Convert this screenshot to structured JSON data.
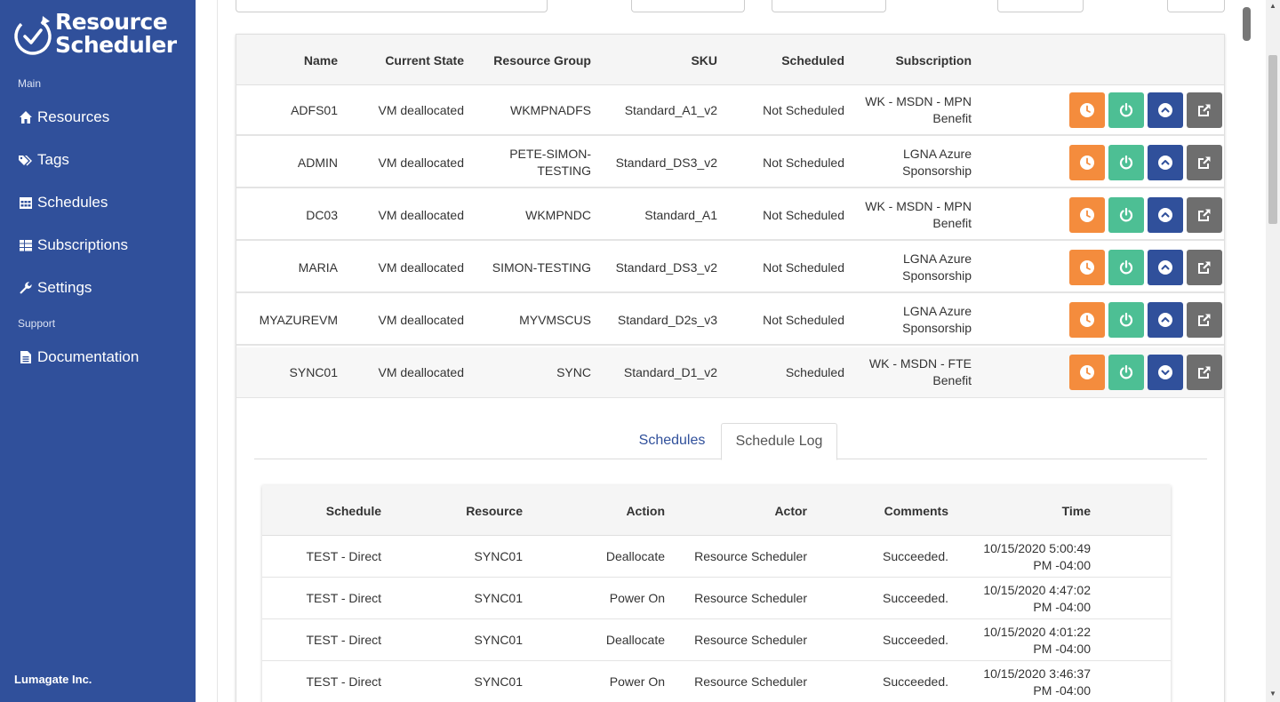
{
  "app": {
    "brand_line1": "Resource",
    "brand_line2": "Scheduler",
    "footer": "Lumagate Inc."
  },
  "sidebar": {
    "sections": [
      "Main",
      "Support"
    ],
    "items": [
      {
        "label": "Resources",
        "icon": "home-icon"
      },
      {
        "label": "Tags",
        "icon": "tags-icon"
      },
      {
        "label": "Schedules",
        "icon": "calendar-icon"
      },
      {
        "label": "Subscriptions",
        "icon": "list-icon"
      },
      {
        "label": "Settings",
        "icon": "wrench-icon"
      },
      {
        "label": "Documentation",
        "icon": "document-icon"
      }
    ]
  },
  "resources_table": {
    "headers": [
      "Name",
      "Current State",
      "Resource Group",
      "SKU",
      "Scheduled",
      "Subscription"
    ],
    "rows": [
      {
        "name": "ADFS01",
        "state": "VM deallocated",
        "group": "WKMPNADFS",
        "sku": "Standard_A1_v2",
        "scheduled": "Not Scheduled",
        "sub1": "WK - MSDN - MPN",
        "sub2": "Benefit",
        "group2": "",
        "expanded": false
      },
      {
        "name": "ADMIN",
        "state": "VM deallocated",
        "group": "PETE-SIMON-",
        "group2": "TESTING",
        "sku": "Standard_DS3_v2",
        "scheduled": "Not Scheduled",
        "sub1": "LGNA Azure",
        "sub2": "Sponsorship",
        "expanded": false
      },
      {
        "name": "DC03",
        "state": "VM deallocated",
        "group": "WKMPNDC",
        "group2": "",
        "sku": "Standard_A1",
        "scheduled": "Not Scheduled",
        "sub1": "WK - MSDN - MPN",
        "sub2": "Benefit",
        "expanded": false
      },
      {
        "name": "MARIA",
        "state": "VM deallocated",
        "group": "SIMON-TESTING",
        "group2": "",
        "sku": "Standard_DS3_v2",
        "scheduled": "Not Scheduled",
        "sub1": "LGNA Azure",
        "sub2": "Sponsorship",
        "expanded": false
      },
      {
        "name": "MYAZUREVM",
        "state": "VM deallocated",
        "group": "MYVMSCUS",
        "group2": "",
        "sku": "Standard_D2s_v3",
        "scheduled": "Not Scheduled",
        "sub1": "LGNA Azure",
        "sub2": "Sponsorship",
        "expanded": false
      },
      {
        "name": "SYNC01",
        "state": "VM deallocated",
        "group": "SYNC",
        "group2": "",
        "sku": "Standard_D1_v2",
        "scheduled": "Scheduled",
        "sub1": "WK - MSDN - FTE",
        "sub2": "Benefit",
        "expanded": true
      }
    ],
    "row_actions": [
      {
        "icon": "clock-icon",
        "color": "#f48c3d"
      },
      {
        "icon": "power-icon",
        "color": "#4dbf94"
      },
      {
        "icon": "chevron-icon",
        "color": "#30509b"
      },
      {
        "icon": "external-link-icon",
        "color": "#6e6e6e"
      }
    ]
  },
  "detail": {
    "tabs": [
      "Schedules",
      "Schedule Log"
    ],
    "active_tab": "Schedule Log",
    "log_headers": [
      "Schedule",
      "Resource",
      "Action",
      "Actor",
      "Comments",
      "Time"
    ],
    "log_rows": [
      {
        "schedule": "TEST - Direct",
        "resource": "SYNC01",
        "action": "Deallocate",
        "actor": "Resource Scheduler",
        "comments": "Succeeded.",
        "time1": "10/15/2020 5:00:49",
        "time2": "PM -04:00"
      },
      {
        "schedule": "TEST - Direct",
        "resource": "SYNC01",
        "action": "Power On",
        "actor": "Resource Scheduler",
        "comments": "Succeeded.",
        "time1": "10/15/2020 4:47:02",
        "time2": "PM -04:00"
      },
      {
        "schedule": "TEST - Direct",
        "resource": "SYNC01",
        "action": "Deallocate",
        "actor": "Resource Scheduler",
        "comments": "Succeeded.",
        "time1": "10/15/2020 4:01:22",
        "time2": "PM -04:00"
      },
      {
        "schedule": "TEST - Direct",
        "resource": "SYNC01",
        "action": "Power On",
        "actor": "Resource Scheduler",
        "comments": "Succeeded.",
        "time1": "10/15/2020 3:46:37",
        "time2": "PM -04:00"
      }
    ]
  },
  "colors": {
    "sidebar": "#30509b",
    "accent_orange": "#f48c3d",
    "accent_green": "#4dbf94",
    "accent_blue": "#30509b",
    "accent_gray": "#6e6e6e"
  }
}
